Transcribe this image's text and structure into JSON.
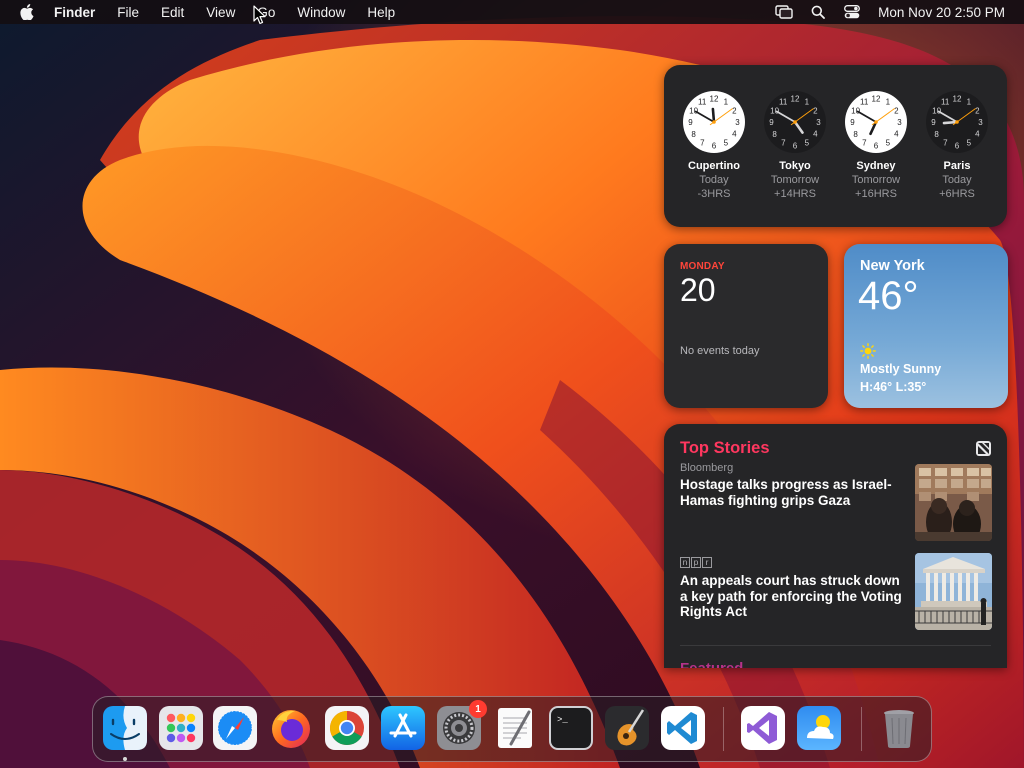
{
  "menubar": {
    "app_name": "Finder",
    "items": [
      "File",
      "Edit",
      "View",
      "Go",
      "Window",
      "Help"
    ],
    "datetime": "Mon Nov 20  2:50 PM"
  },
  "widgets": {
    "world_clock": [
      {
        "city": "Cupertino",
        "day": "Today",
        "offset": "-3HRS",
        "theme": "light",
        "hour": 11,
        "minute": 50
      },
      {
        "city": "Tokyo",
        "day": "Tomorrow",
        "offset": "+14HRS",
        "theme": "dark",
        "hour": 4,
        "minute": 50
      },
      {
        "city": "Sydney",
        "day": "Tomorrow",
        "offset": "+16HRS",
        "theme": "light",
        "hour": 6,
        "minute": 50
      },
      {
        "city": "Paris",
        "day": "Today",
        "offset": "+6HRS",
        "theme": "dark",
        "hour": 8,
        "minute": 50
      }
    ],
    "calendar": {
      "weekday": "MONDAY",
      "date": "20",
      "events": "No events today"
    },
    "weather": {
      "city": "New York",
      "temperature": "46°",
      "condition": "Mostly Sunny",
      "high_low": "H:46° L:35°"
    },
    "news": {
      "title": "Top Stories",
      "stories": [
        {
          "source": "Bloomberg",
          "headline": "Hostage talks progress as Israel-Hamas fighting grips Gaza"
        },
        {
          "source": "npr",
          "headline": "An appeals court has struck down a key path for enforcing the Voting Rights Act"
        }
      ],
      "section": "Featured"
    }
  },
  "dock": {
    "apps": [
      {
        "name": "Finder",
        "icon": "finder-icon"
      },
      {
        "name": "Launchpad",
        "icon": "launchpad-icon"
      },
      {
        "name": "Safari",
        "icon": "safari-icon"
      },
      {
        "name": "Firefox",
        "icon": "firefox-icon"
      },
      {
        "name": "Google Chrome",
        "icon": "chrome-icon"
      },
      {
        "name": "App Store",
        "icon": "app-store-icon"
      },
      {
        "name": "System Settings",
        "icon": "settings-icon",
        "badge": "1"
      },
      {
        "name": "TextEdit",
        "icon": "textedit-icon"
      },
      {
        "name": "Terminal",
        "icon": "terminal-icon"
      },
      {
        "name": "GarageBand",
        "icon": "garageband-icon"
      },
      {
        "name": "Visual Studio Code",
        "icon": "vscode-icon"
      },
      {
        "name": "Visual Studio",
        "icon": "visual-studio-icon"
      },
      {
        "name": "Weather",
        "icon": "weather-icon"
      },
      {
        "name": "Trash",
        "icon": "trash-icon"
      }
    ]
  },
  "colors": {
    "accent_red": "#ff453a",
    "news_pink": "#ff375f",
    "badge_red": "#ff3b30"
  }
}
